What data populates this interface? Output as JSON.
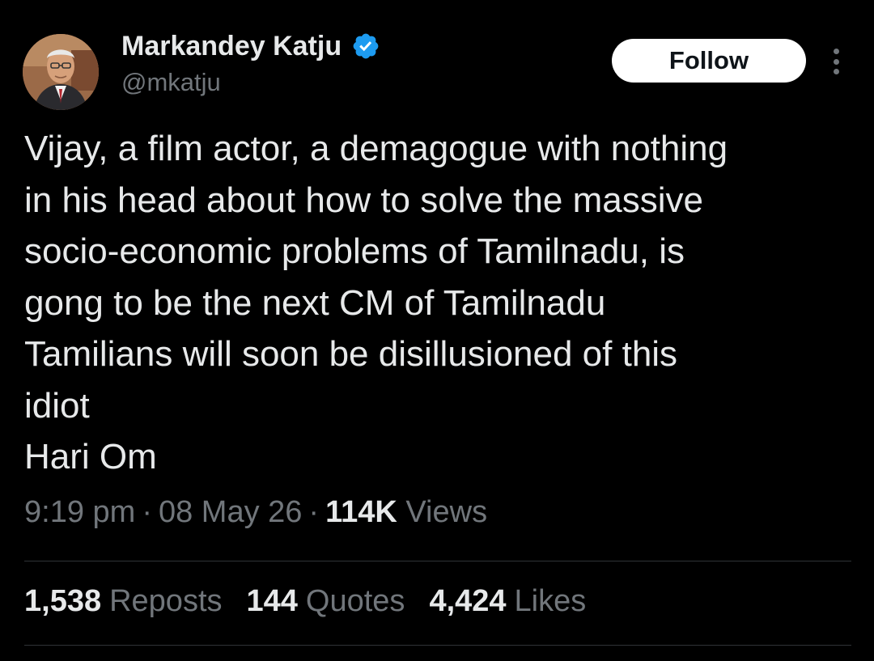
{
  "author": {
    "display_name": "Markandey Katju",
    "handle": "@mkatju",
    "verified": true,
    "avatar_icon": "profile-photo"
  },
  "actions": {
    "follow_label": "Follow",
    "more_icon": "more-vertical-icon"
  },
  "tweet": {
    "lines": [
      "Vijay, a film actor, a demagogue with nothing",
      "in his head about how to solve the massive",
      "socio-economic problems of Tamilnadu, is",
      "gong to be the next CM of Tamilnadu",
      "Tamilians will soon be disillusioned of this",
      "idiot",
      "Hari Om"
    ]
  },
  "meta": {
    "time": "9:19 pm",
    "separator": "·",
    "date": "08 May 26",
    "views_count": "114K",
    "views_label": "Views"
  },
  "stats": {
    "reposts_count": "1,538",
    "reposts_label": "Reposts",
    "quotes_count": "144",
    "quotes_label": "Quotes",
    "likes_count": "4,424",
    "likes_label": "Likes"
  },
  "colors": {
    "background": "#000000",
    "primary_text": "#e7e9ea",
    "secondary_text": "#71767b",
    "verified_blue": "#1d9bf0",
    "divider": "#2f3336",
    "button_bg": "#ffffff"
  }
}
